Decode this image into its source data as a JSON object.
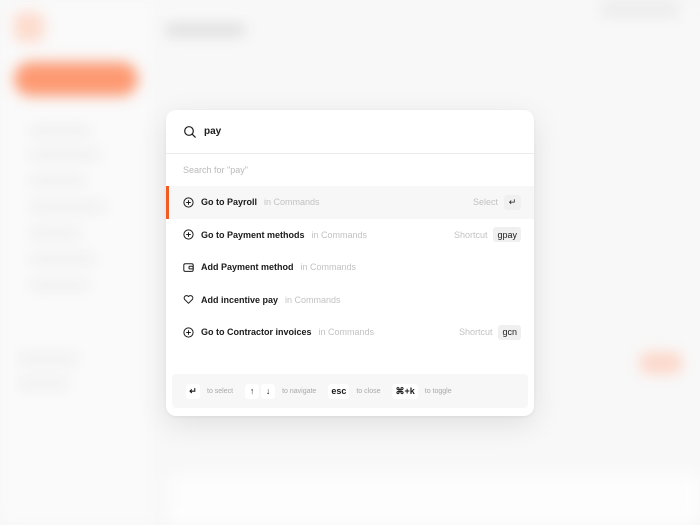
{
  "search": {
    "value": "pay",
    "hint": "Search for \"pay\""
  },
  "results": [
    {
      "icon": "plus-circle-icon",
      "label": "Go to Payroll",
      "context": "in Commands",
      "right_hint": "Select",
      "key": "↵",
      "active": true
    },
    {
      "icon": "plus-circle-icon",
      "label": "Go to Payment methods",
      "context": "in Commands",
      "right_hint": "Shortcut",
      "key": "gpay",
      "active": false
    },
    {
      "icon": "wallet-icon",
      "label": "Add Payment method",
      "context": "in Commands",
      "right_hint": "",
      "key": "",
      "active": false
    },
    {
      "icon": "heart-icon",
      "label": "Add incentive pay",
      "context": "in Commands",
      "right_hint": "",
      "key": "",
      "active": false
    },
    {
      "icon": "plus-circle-icon",
      "label": "Go to Contractor invoices",
      "context": "in Commands",
      "right_hint": "Shortcut",
      "key": "gcn",
      "active": false
    }
  ],
  "footer": [
    {
      "keys": [
        "↵"
      ],
      "label": "to select"
    },
    {
      "keys": [
        "↑",
        "↓"
      ],
      "label": "to navigate"
    },
    {
      "keys": [
        "esc"
      ],
      "label": "to close"
    },
    {
      "keys": [
        "⌘+k"
      ],
      "label": "to toggle"
    }
  ],
  "colors": {
    "accent": "#f25c23",
    "muted_text": "#c2c2c2"
  }
}
